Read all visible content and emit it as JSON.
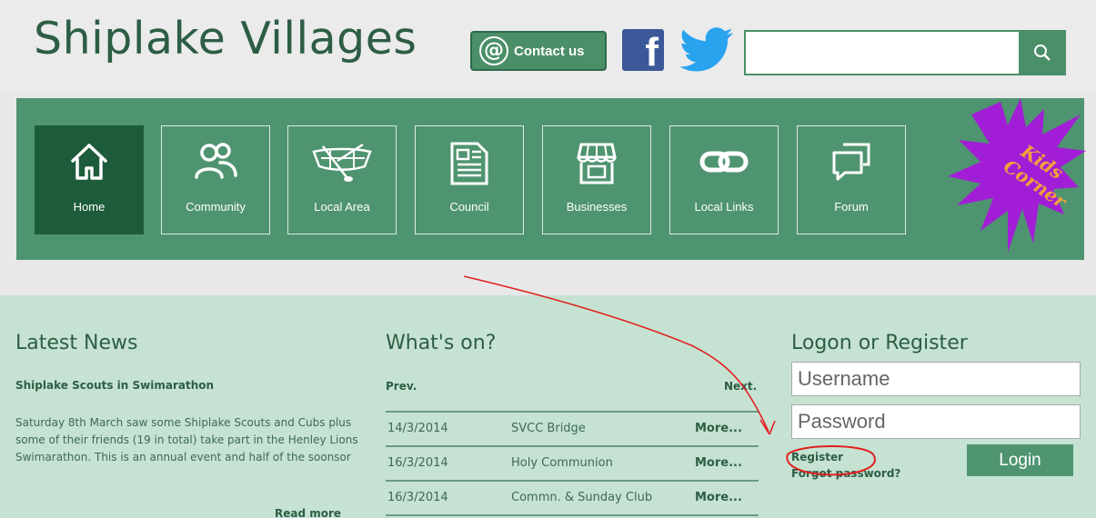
{
  "header": {
    "site_title": "Shiplake Villages",
    "contact_label": "Contact us",
    "contact_icon": "@",
    "facebook_glyph": "f",
    "search": {
      "value": "",
      "placeholder": ""
    }
  },
  "nav": {
    "items": [
      {
        "label": "Home",
        "icon": "home-icon",
        "active": true
      },
      {
        "label": "Community",
        "icon": "people-icon",
        "active": false
      },
      {
        "label": "Local Area",
        "icon": "rowing-boat-icon",
        "active": false
      },
      {
        "label": "Council",
        "icon": "newspaper-icon",
        "active": false
      },
      {
        "label": "Businesses",
        "icon": "shop-icon",
        "active": false
      },
      {
        "label": "Local Links",
        "icon": "link-icon",
        "active": false
      },
      {
        "label": "Forum",
        "icon": "chat-icon",
        "active": false
      }
    ],
    "kids_corner": {
      "line1": "Kids",
      "line2": "Corner"
    }
  },
  "news": {
    "title": "Latest News",
    "headline": "Shiplake Scouts in Swimarathon",
    "body": "Saturday 8th March saw some Shiplake Scouts and Cubs plus some of their friends (19 in total) take part in the Henley Lions Swimarathon. This is an annual event and half of the soonsor",
    "read_more": "Read more"
  },
  "events": {
    "title": "What's on?",
    "prev": "Prev.",
    "next": "Next.",
    "rows": [
      {
        "date": "14/3/2014",
        "name": "SVCC Bridge",
        "more": "More..."
      },
      {
        "date": "16/3/2014",
        "name": "Holy Communion",
        "more": "More..."
      },
      {
        "date": "16/3/2014",
        "name": "Commn. & Sunday Club",
        "more": "More..."
      }
    ]
  },
  "login": {
    "title": "Logon or Register",
    "username": {
      "value": "",
      "placeholder": "Username"
    },
    "password": {
      "value": "",
      "placeholder": "Password"
    },
    "register": "Register",
    "forgot": "Forgot password?",
    "button": "Login"
  },
  "colors": {
    "brand_green": "#4f9470",
    "dark_green": "#1d5c3b",
    "content_bg": "#c6e2d2",
    "title_text": "#2d5e45",
    "annotation_red": "#e02020",
    "kids_splash": "#a21ed6",
    "kids_text": "#f0a03c"
  }
}
